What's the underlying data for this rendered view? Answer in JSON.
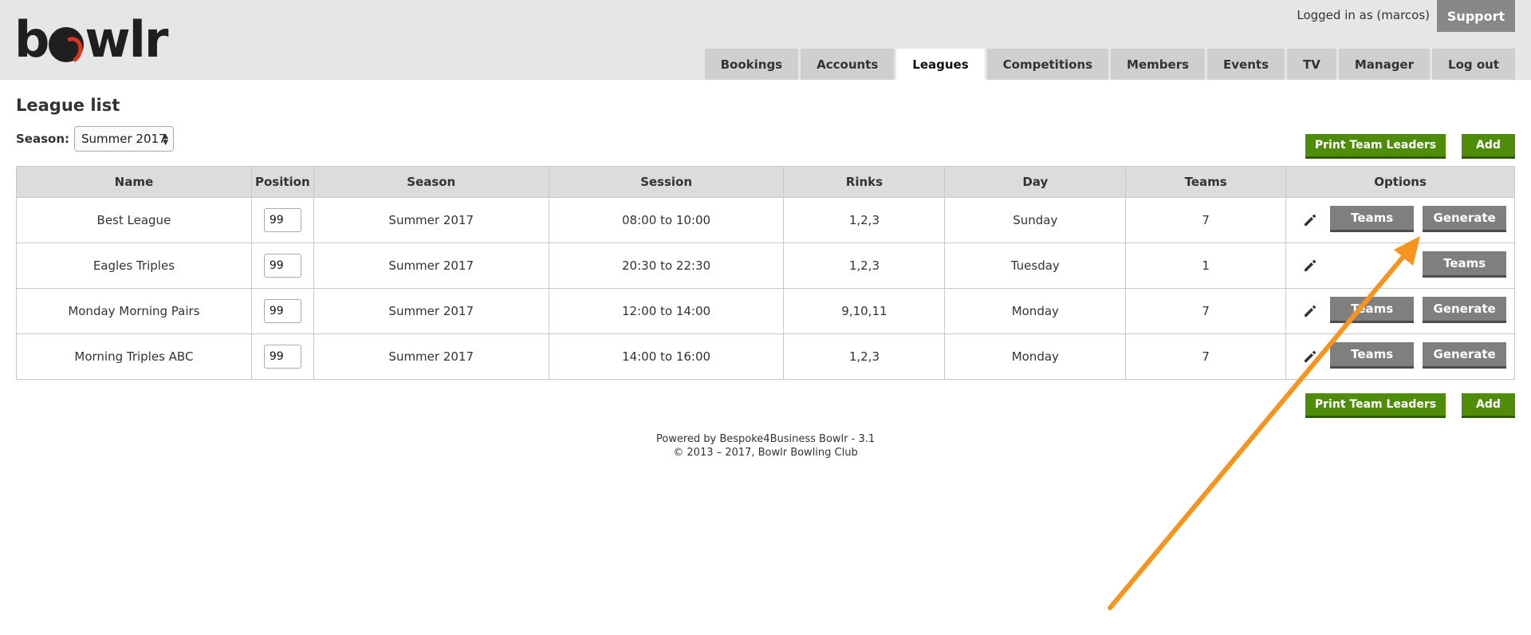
{
  "app": {
    "logo_text": "bowlr",
    "logged_in_text": "Logged in as (marcos)",
    "support_label": "Support"
  },
  "nav": {
    "tabs": [
      {
        "label": "Bookings"
      },
      {
        "label": "Accounts"
      },
      {
        "label": "Leagues",
        "active": true
      },
      {
        "label": "Competitions"
      },
      {
        "label": "Members"
      },
      {
        "label": "Events"
      },
      {
        "label": "TV"
      },
      {
        "label": "Manager"
      },
      {
        "label": "Log out"
      }
    ]
  },
  "page": {
    "title": "League list",
    "season_label": "Season:",
    "season_value": "Summer 2017",
    "print_label": "Print Team Leaders",
    "add_label": "Add"
  },
  "table": {
    "headers": [
      "Name",
      "Position",
      "Season",
      "Session",
      "Rinks",
      "Day",
      "Teams",
      "Options"
    ],
    "rows": [
      {
        "name": "Best League",
        "position": "99",
        "season": "Summer 2017",
        "session": "08:00 to 10:00",
        "rinks": "1,2,3",
        "day": "Sunday",
        "teams": "7",
        "btn_teams": "Teams",
        "btn_second": "Generate"
      },
      {
        "name": "Eagles Triples",
        "position": "99",
        "season": "Summer 2017",
        "session": "20:30 to 22:30",
        "rinks": "1,2,3",
        "day": "Tuesday",
        "teams": "1",
        "btn_teams": "",
        "btn_second": "Teams"
      },
      {
        "name": "Monday Morning Pairs",
        "position": "99",
        "season": "Summer 2017",
        "session": "12:00 to 14:00",
        "rinks": "9,10,11",
        "day": "Monday",
        "teams": "7",
        "btn_teams": "Teams",
        "btn_second": "Generate"
      },
      {
        "name": "Morning Triples ABC",
        "position": "99",
        "season": "Summer 2017",
        "session": "14:00 to 16:00",
        "rinks": "1,2,3",
        "day": "Monday",
        "teams": "7",
        "btn_teams": "Teams",
        "btn_second": "Generate"
      }
    ]
  },
  "footer": {
    "line1": "Powered by Bespoke4Business Bowlr - 3.1",
    "line2": "© 2013 – 2017, Bowlr Bowling Club"
  },
  "colors": {
    "green_button": "#4f8c0a",
    "grey_button": "#7f7f7f",
    "annotation_arrow": "#f7941d",
    "header_bg": "#e6e6e6"
  },
  "icons": {
    "edit": "pencil-icon",
    "annotation": "arrow-annotation"
  }
}
